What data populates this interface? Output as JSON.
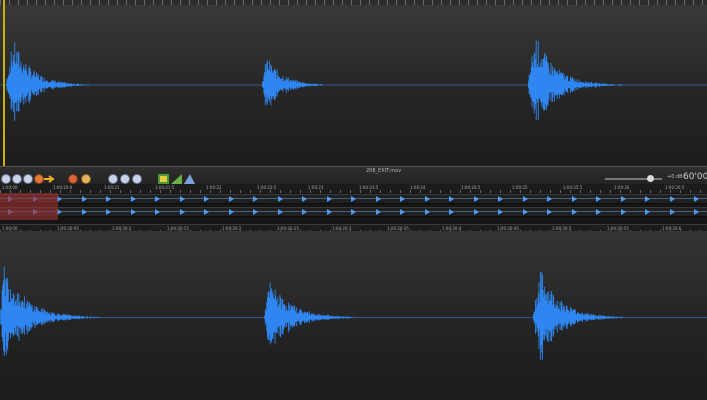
{
  "app": {
    "filename": "208_EXIT.mov",
    "gain_label": "+0 dB",
    "zoom_label": "60'00\""
  },
  "colors": {
    "waveform": "#2f86f0",
    "cursor": "#c8b400",
    "selection": "#963232"
  },
  "toolbar_icons": [
    "play-icon",
    "rewind-icon",
    "pause-icon",
    "record-icon",
    "arrow-right-icon",
    "marker-red-icon",
    "marker-orange-icon",
    "zoom-in-icon",
    "zoom-out-icon",
    "zoom-fit-icon",
    "spectrum-icon",
    "level-icon",
    "meter-icon"
  ],
  "ruler_top": [
    "1:00:00",
    "1:00:20:0",
    "1:00:21",
    "1:00:21:5",
    "1:00:22",
    "1:00:22:5",
    "1:00:23",
    "1:00:23:5",
    "1:00:24",
    "1:00:24:5",
    "1:00:25",
    "1:00:25:5",
    "1:00:26",
    "1:00:26:5"
  ],
  "ruler_bottom": [
    "1:00:00",
    "1:00:20:05",
    "1:00:20:1",
    "1:00:20:15",
    "1:00:20:2",
    "1:00:20:25",
    "1:00:20:3",
    "1:00:20:35",
    "1:00:20:4",
    "1:00:20:45",
    "1:00:20:5",
    "1:00:20:55",
    "1:00:20:6"
  ]
}
